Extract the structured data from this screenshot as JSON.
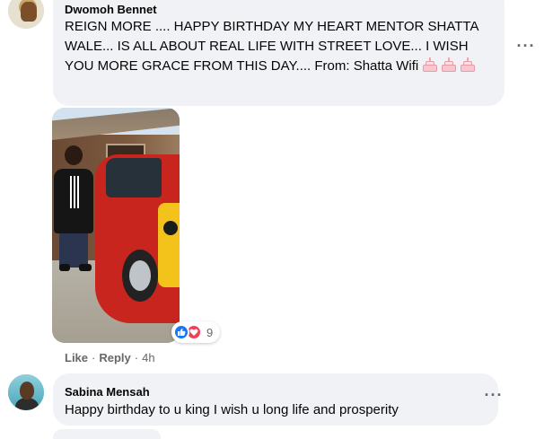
{
  "comments": [
    {
      "author": "Dwomoh Bennet",
      "text": "REIGN MORE .... HAPPY BIRTHDAY MY HEART MENTOR SHATTA WALE... IS ALL ABOUT REAL LIFE WITH STREET LOVE... I WISH YOU MORE GRACE FROM THIS DAY.... From: Shatta Wifi",
      "emoji_icons": [
        "birthday-cake-icon",
        "birthday-cake-icon",
        "birthday-cake-icon"
      ],
      "more_label": "···",
      "reactions": {
        "icons": [
          "like-icon",
          "love-icon"
        ],
        "count": "9"
      },
      "actions": {
        "like": "Like",
        "reply": "Reply",
        "separator": "·",
        "time": "4h"
      }
    },
    {
      "author": "Sabina Mensah",
      "text": "Happy birthday to u king I wish u long life and prosperity",
      "more_label": "···"
    }
  ],
  "colors": {
    "bubble": "#f0f2f5",
    "meta_text": "#65676b",
    "like_blue": "#1877f2",
    "love_red": "#f33e58"
  }
}
